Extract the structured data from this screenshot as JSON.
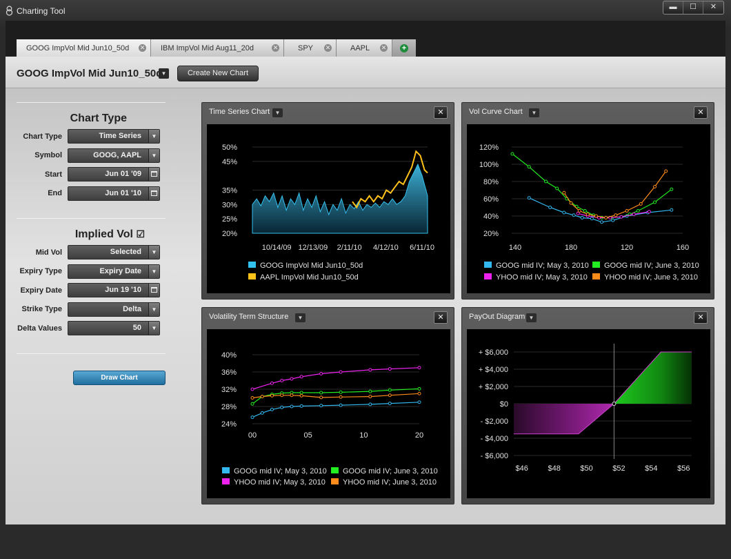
{
  "window": {
    "title": "Charting Tool",
    "btn_min": "▬",
    "btn_max": "☐",
    "btn_close": "✕"
  },
  "tabs": [
    {
      "label": "GOOG ImpVol Mid Jun10_50d",
      "close": "✕"
    },
    {
      "label": "IBM ImpVol Mid Aug11_20d",
      "close": "✕"
    },
    {
      "label": "SPY",
      "close": "✕"
    },
    {
      "label": "AAPL",
      "close": "✕"
    }
  ],
  "add_tab": "+",
  "toolbar": {
    "title": "GOOG ImpVol Mid Jun10_50d",
    "dropdown": "▼",
    "create_label": "Create New Chart"
  },
  "chart_type_section": {
    "heading": "Chart Type",
    "fields": [
      {
        "label": "Chart Type",
        "value": "Time Series",
        "control": "dropdown"
      },
      {
        "label": "Symbol",
        "value": "GOOG, AAPL",
        "control": "dropdown"
      },
      {
        "label": "Start",
        "value": "Jun 01 '09",
        "control": "calendar"
      },
      {
        "label": "End",
        "value": "Jun 01 '10",
        "control": "calendar"
      }
    ]
  },
  "implied_vol_section": {
    "heading": "Implied Vol",
    "checkbox": "☑",
    "fields": [
      {
        "label": "Mid Vol",
        "value": "Selected",
        "control": "dropdown"
      },
      {
        "label": "Expiry Type",
        "value": "Expiry Date",
        "control": "dropdown"
      },
      {
        "label": "Expiry Date",
        "value": "Jun 19 '10",
        "control": "calendar"
      },
      {
        "label": "Strike Type",
        "value": "Delta",
        "control": "dropdown"
      },
      {
        "label": "Delta Values",
        "value": "50",
        "control": "dropdown"
      }
    ]
  },
  "draw_chart_label": "Draw Chart",
  "icons": {
    "dropdown": "chevron-down-icon",
    "calendar": "calendar-icon",
    "close": "close-icon",
    "add": "plus-icon",
    "checkbox": "checkbox-icon"
  },
  "panels": [
    {
      "title": "Time Series Chart",
      "close": "✕",
      "drop": "▼"
    },
    {
      "title": "Vol Curve Chart",
      "close": "✕",
      "drop": "▼"
    },
    {
      "title": "Volatility Term Structure",
      "close": "✕",
      "drop": "▼"
    },
    {
      "title": "PayOut Diagram",
      "close": "✕",
      "drop": "▼"
    }
  ],
  "chart_data": [
    {
      "type": "area",
      "title": "Time Series Chart",
      "x_ticks": [
        "10/14/09",
        "12/13/09",
        "2/11/10",
        "4/12/10",
        "6/11/10"
      ],
      "y_ticks": [
        "50%",
        "45%",
        "35%",
        "30%",
        "25%",
        "20%"
      ],
      "ylim": [
        20,
        50
      ],
      "xlim": [
        "9/4/09",
        "6/20/10"
      ],
      "series": [
        {
          "name": "GOOG ImpVol Mid Jun10_50d",
          "color": "#33c2f0",
          "style": "area",
          "x": [
            "9/4/09",
            "9/11/09",
            "9/18/09",
            "9/25/09",
            "10/2/09",
            "10/9/09",
            "10/16/09",
            "10/23/09",
            "10/30/09",
            "11/6/09",
            "11/13/09",
            "11/20/09",
            "11/27/09",
            "12/4/09",
            "12/11/09",
            "12/18/09",
            "12/25/09",
            "1/1/10",
            "1/8/10",
            "1/15/10",
            "1/22/10",
            "1/29/10",
            "2/5/10",
            "2/12/10",
            "2/19/10",
            "2/26/10",
            "3/5/10",
            "3/12/10",
            "3/19/10",
            "3/26/10",
            "4/2/10",
            "4/9/10",
            "4/16/10",
            "4/23/10",
            "4/30/10",
            "5/7/10",
            "5/14/10",
            "5/21/10",
            "5/28/10",
            "6/4/10",
            "6/11/10",
            "6/20/10"
          ],
          "y": [
            30,
            32,
            29.5,
            33,
            31,
            34,
            29,
            33,
            28,
            32,
            30,
            34,
            28,
            32,
            29,
            33,
            27.5,
            31,
            26.5,
            30,
            28,
            32,
            27,
            30,
            28.5,
            31,
            28,
            30,
            29,
            30.5,
            29,
            31,
            30,
            32,
            30,
            31,
            33,
            38,
            41,
            44,
            40,
            33
          ]
        },
        {
          "name": "AAPL ImpVol Mid Jun10_50d",
          "color": "#ffc21a",
          "style": "line",
          "x": [
            "2/16/10",
            "2/23/10",
            "3/2/10",
            "3/9/10",
            "3/16/10",
            "3/23/10",
            "3/30/10",
            "4/6/10",
            "4/13/10",
            "4/20/10",
            "4/27/10",
            "5/4/10",
            "5/11/10",
            "5/18/10",
            "5/25/10",
            "6/1/10",
            "6/8/10",
            "6/15/10",
            "6/20/10"
          ],
          "y": [
            31,
            29,
            32,
            31,
            33,
            31,
            33,
            32,
            35,
            34,
            36,
            38,
            37,
            40,
            43,
            48.5,
            47,
            42,
            41
          ]
        }
      ]
    },
    {
      "type": "line",
      "title": "Vol Curve Chart",
      "x_ticks": [
        "140",
        "180",
        "120",
        "160"
      ],
      "y_ticks": [
        "120%",
        "100%",
        "80%",
        "60%",
        "40%",
        "20%"
      ],
      "ylim": [
        20,
        120
      ],
      "series": [
        {
          "name": "GOOG mid IV; May 3, 2010",
          "color": "#33b8f0",
          "x": [
            150,
            165,
            175,
            182,
            188,
            195,
            202,
            210,
            220,
            235,
            252
          ],
          "y": [
            61,
            50,
            44,
            41,
            38,
            37,
            33,
            35,
            40,
            44,
            47
          ]
        },
        {
          "name": "GOOG  mid IV; June 3, 2010",
          "color": "#22ee22",
          "x": [
            138,
            150,
            162,
            170,
            177,
            184,
            190,
            196,
            202,
            209,
            216,
            222,
            228,
            240,
            252
          ],
          "y": [
            112,
            97,
            80,
            72,
            60,
            51,
            46,
            41,
            38,
            38,
            39,
            42,
            46,
            56,
            71
          ]
        },
        {
          "name": "YHOO mid IV; May 3, 2010",
          "color": "#ee22ee",
          "x": [
            185,
            192,
            200,
            208,
            216,
            225,
            236
          ],
          "y": [
            43,
            40,
            38,
            38,
            39,
            42,
            45
          ]
        },
        {
          "name": "YHOO  mid IV; June 3, 2010",
          "color": "#ff8c1a",
          "x": [
            175,
            180,
            186,
            192,
            198,
            205,
            212,
            220,
            230,
            240,
            248
          ],
          "y": [
            67,
            55,
            46,
            42,
            40,
            38,
            41,
            46,
            54,
            74,
            92
          ]
        }
      ]
    },
    {
      "type": "line",
      "title": "Volatility Term Structure",
      "x_ticks": [
        "00",
        "05",
        "10",
        "20"
      ],
      "y_ticks": [
        "40%",
        "36%",
        "32%",
        "28%",
        "24%"
      ],
      "ylim": [
        24,
        40
      ],
      "series": [
        {
          "name": "GOOG mid IV; May 3, 2010",
          "color": "#33b8f0",
          "x": [
            0,
            1,
            2,
            3,
            4,
            5,
            7,
            9,
            12,
            14,
            17
          ],
          "y": [
            25.5,
            26.5,
            27.3,
            27.8,
            28.0,
            28.1,
            28.2,
            28.3,
            28.5,
            28.7,
            29.0
          ]
        },
        {
          "name": "GOOG  mid IV; June 3, 2010",
          "color": "#22ee22",
          "x": [
            0,
            1,
            2,
            3,
            4,
            5,
            7,
            9,
            12,
            14,
            17
          ],
          "y": [
            28.6,
            30.3,
            30.8,
            31.1,
            31.2,
            31.2,
            31.2,
            31.3,
            31.5,
            31.8,
            32.1
          ]
        },
        {
          "name": "YHOO mid IV; May 3, 2010",
          "color": "#ee22ee",
          "x": [
            0,
            2,
            3,
            4,
            5,
            7,
            9,
            12,
            14,
            17
          ],
          "y": [
            32.0,
            33.4,
            34.0,
            34.4,
            34.9,
            35.6,
            36.0,
            36.5,
            36.7,
            37.0
          ]
        },
        {
          "name": "YHOO  mid IV; June 3, 2010",
          "color": "#ff8c1a",
          "x": [
            0,
            1,
            2,
            3,
            4,
            5,
            7,
            9,
            12,
            14,
            17
          ],
          "y": [
            30.0,
            30.3,
            30.5,
            30.6,
            30.6,
            30.5,
            30.1,
            30.2,
            30.3,
            30.6,
            31.0
          ]
        }
      ]
    },
    {
      "type": "area",
      "title": "PayOut Diagram",
      "x_ticks": [
        "$46",
        "$48",
        "$50",
        "$52",
        "$54",
        "$56"
      ],
      "y_ticks": [
        "+ $6,000",
        "+ $4,000",
        "+ $2,000",
        "$0",
        "- $2,000",
        "- $4,000",
        "- $6,000"
      ],
      "xlim": [
        45.5,
        56.5
      ],
      "ylim": [
        -6000,
        6000
      ],
      "breakeven": {
        "x": 51.7,
        "y": 0
      },
      "payoff": {
        "x": [
          45.5,
          49.5,
          51.7,
          54.6,
          56.5
        ],
        "y": [
          -3500,
          -3500,
          0,
          6000,
          6000
        ]
      }
    }
  ]
}
